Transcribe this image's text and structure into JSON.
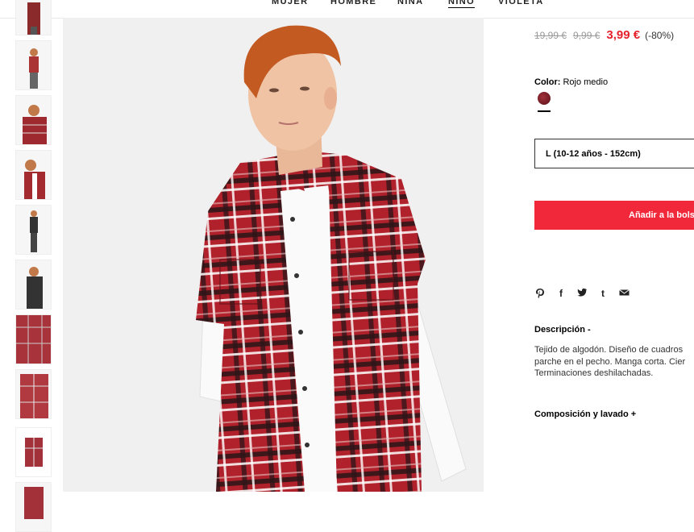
{
  "nav": {
    "items": [
      "MUJER",
      "HOMBRE",
      "NIÑA",
      "NIÑO",
      "VIOLETA"
    ],
    "active": "NIÑO"
  },
  "product": {
    "price_original_1": "19,99 €",
    "price_original_2": "9,99 €",
    "price_sale": "3,99 €",
    "discount": "(-80%)",
    "color_label": "Color:",
    "color_value": "Rojo medio",
    "size_selected": "L (10-12 años - 152cm)",
    "add_button": "Añadir a la bolsa",
    "description_title": "Descripción -",
    "description_lines": [
      "Tejido de algodón. Diseño de cuadros",
      "parche en el pecho. Manga corta. Cier",
      "Terminaciones deshilachadas."
    ],
    "composition_title": "Composición y lavado +"
  },
  "share_icons": [
    "pinterest-icon",
    "facebook-icon",
    "twitter-icon",
    "tumblr-icon",
    "email-icon"
  ],
  "colors": {
    "sale": "#e5222c",
    "button": "#f0283a",
    "shirt_red": "#b0212b"
  }
}
